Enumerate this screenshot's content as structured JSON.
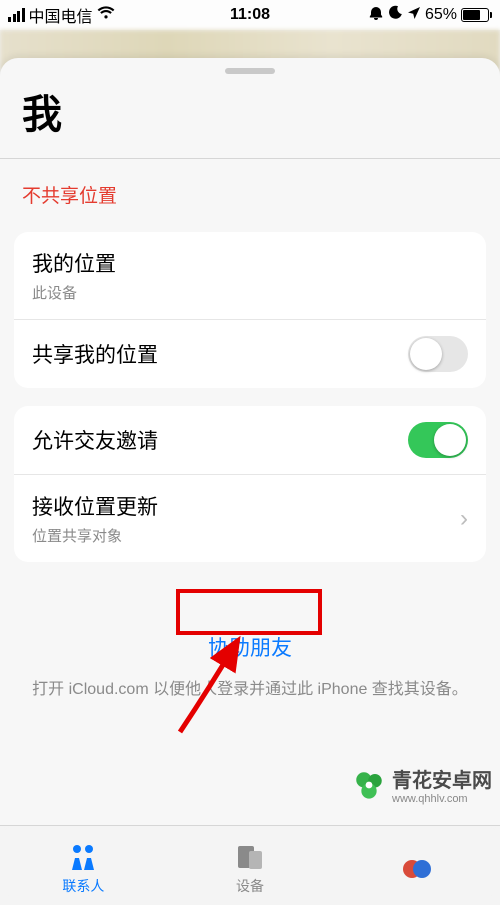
{
  "status_bar": {
    "carrier": "中国电信",
    "time": "11:08",
    "battery_pct": "65%"
  },
  "sheet": {
    "title": "我",
    "stop_sharing": "不共享位置",
    "group1": {
      "my_location": {
        "label": "我的位置",
        "sub": "此设备"
      },
      "share_my_location": {
        "label": "共享我的位置",
        "toggle": "off"
      }
    },
    "group2": {
      "allow_friend_requests": {
        "label": "允许交友邀请",
        "toggle": "on"
      },
      "receive_location_updates": {
        "label": "接收位置更新",
        "sub": "位置共享对象"
      }
    },
    "help": {
      "link": "协助朋友",
      "desc": "打开 iCloud.com 以便他人登录并通过此 iPhone 查找其设备。"
    }
  },
  "tabs": {
    "people": "联系人",
    "devices": "设备"
  },
  "watermark": {
    "text": "青花安卓网",
    "url": "www.qhhlv.com"
  }
}
